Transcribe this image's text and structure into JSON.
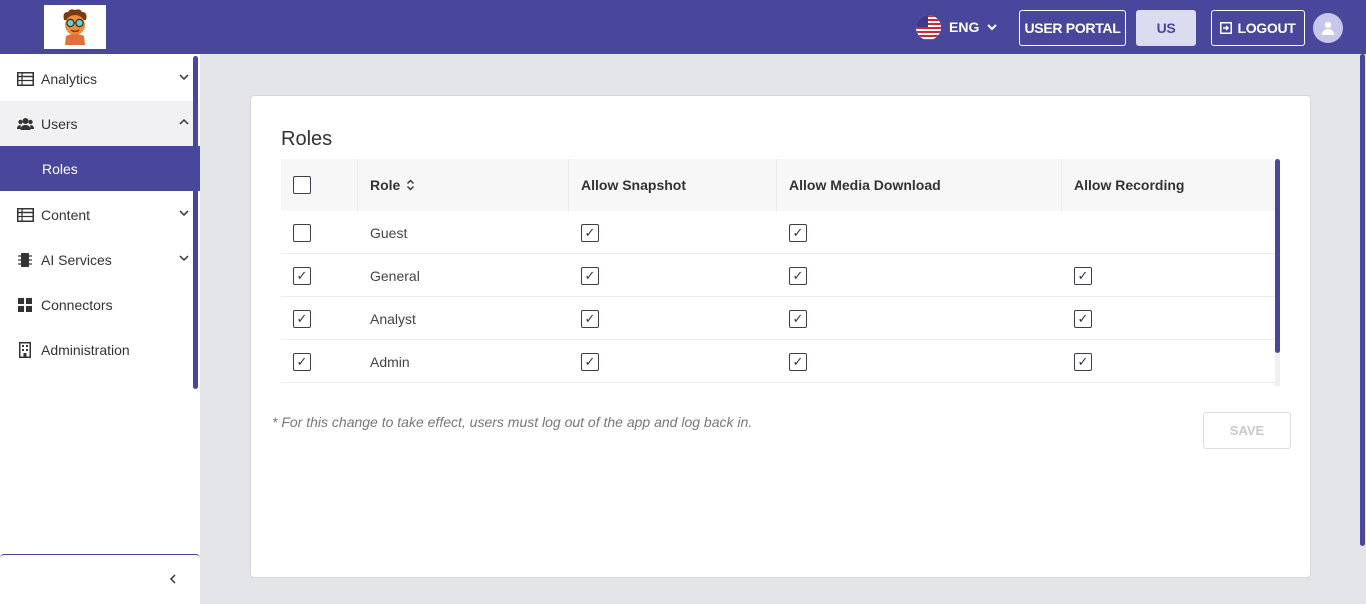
{
  "header": {
    "language": "ENG",
    "user_portal_label": "USER PORTAL",
    "region_label": "US",
    "logout_label": "LOGOUT"
  },
  "sidebar": {
    "items": [
      {
        "label": "Analytics",
        "icon": "table-icon"
      },
      {
        "label": "Users",
        "icon": "users-icon"
      },
      {
        "label": "Roles",
        "icon": ""
      },
      {
        "label": "Content",
        "icon": "table-icon"
      },
      {
        "label": "AI Services",
        "icon": "chip-icon"
      },
      {
        "label": "Connectors",
        "icon": "grid-icon"
      },
      {
        "label": "Administration",
        "icon": "building-icon"
      }
    ]
  },
  "main": {
    "title": "Roles",
    "columns": [
      "Role",
      "Allow Snapshot",
      "Allow Media Download",
      "Allow Recording"
    ],
    "rows": [
      {
        "role": "Guest",
        "selected": false,
        "snapshot": true,
        "media_download": true,
        "recording": false
      },
      {
        "role": "General",
        "selected": true,
        "snapshot": true,
        "media_download": true,
        "recording": true
      },
      {
        "role": "Analyst",
        "selected": true,
        "snapshot": true,
        "media_download": true,
        "recording": true
      },
      {
        "role": "Admin",
        "selected": true,
        "snapshot": true,
        "media_download": true,
        "recording": true
      }
    ],
    "note": "* For this change to take effect, users must log out of the app and log back in.",
    "save_label": "SAVE"
  },
  "colors": {
    "accent": "#48479b",
    "background": "#e4e5e8"
  }
}
